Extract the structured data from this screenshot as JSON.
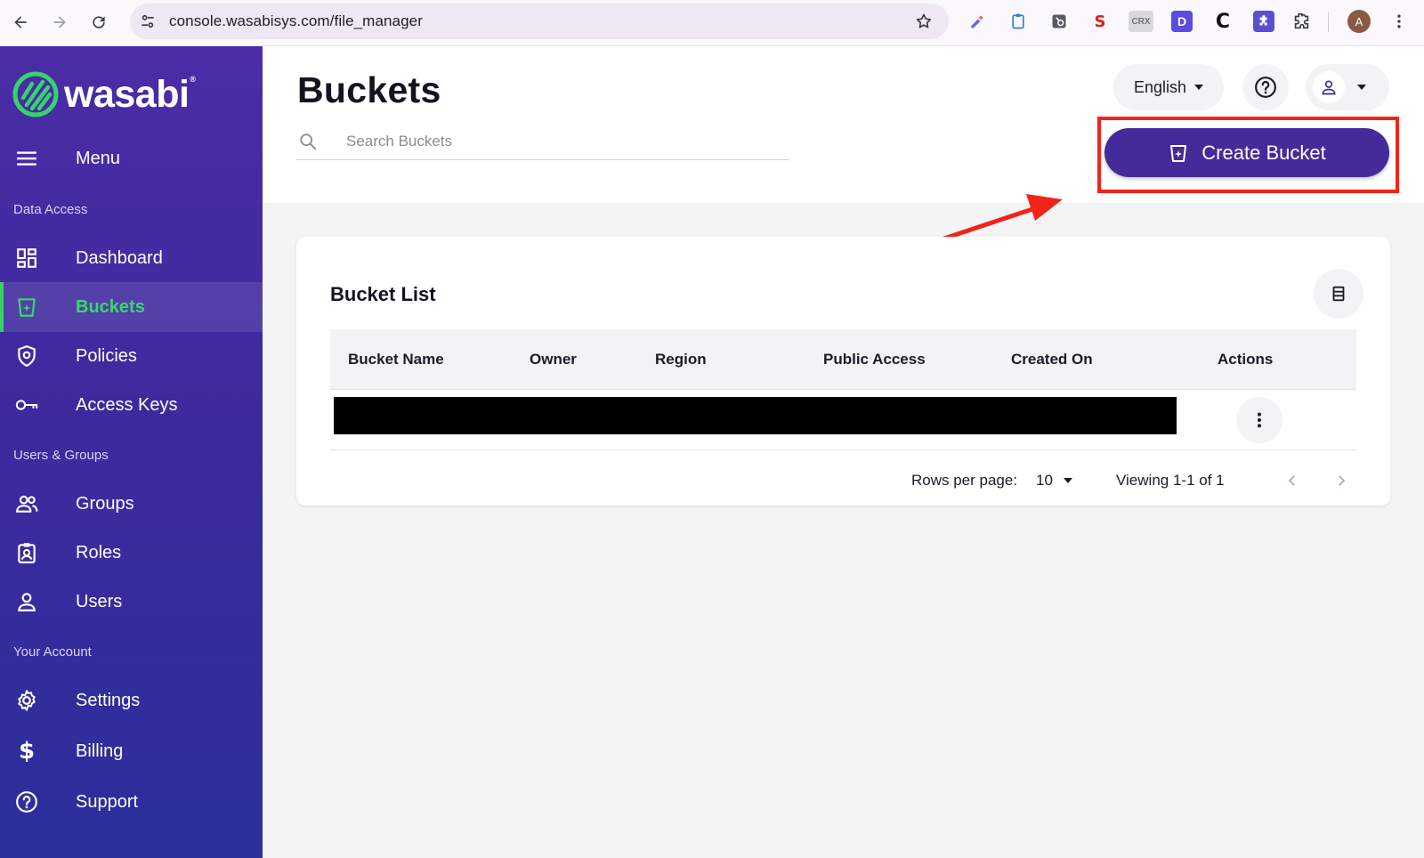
{
  "browser": {
    "url": "console.wasabisys.com/file_manager",
    "profile_initial": "A",
    "extensions": [
      {
        "name": "pen-extension-icon",
        "label": "",
        "color": "#6a6ad8"
      },
      {
        "name": "clipboard-extension-icon",
        "label": "",
        "color": "#3a7bd5"
      },
      {
        "name": "hubspot-extension-icon",
        "label": "",
        "color": "#5a5a66"
      },
      {
        "name": "seo-extension-icon",
        "label": "S",
        "color": "#d6231e"
      },
      {
        "name": "crx-extension-icon",
        "label": "CRX",
        "color": "#777777"
      },
      {
        "name": "d-extension-icon",
        "label": "D",
        "color": "#5b4bdf"
      },
      {
        "name": "c-extension-icon",
        "label": "C",
        "color": "#111111"
      },
      {
        "name": "puzzle-purple-extension-icon",
        "label": "",
        "color": "#5a4fcf"
      },
      {
        "name": "extensions-puzzle-icon",
        "label": "",
        "color": "#3a3a44"
      }
    ]
  },
  "brand": {
    "name": "wasabi",
    "trademark": "®",
    "logo_color": "#35d36c"
  },
  "sidebar": {
    "menu_label": "Menu",
    "sections": {
      "data_access": "Data Access",
      "users_groups": "Users & Groups",
      "your_account": "Your Account"
    },
    "items": [
      {
        "key": "dashboard",
        "label": "Dashboard",
        "icon": "dashboard-icon",
        "active": false
      },
      {
        "key": "buckets",
        "label": "Buckets",
        "icon": "bucket-icon",
        "active": true
      },
      {
        "key": "policies",
        "label": "Policies",
        "icon": "shield-icon",
        "active": false
      },
      {
        "key": "access_keys",
        "label": "Access Keys",
        "icon": "key-icon",
        "active": false
      },
      {
        "key": "groups",
        "label": "Groups",
        "icon": "group-icon",
        "active": false
      },
      {
        "key": "roles",
        "label": "Roles",
        "icon": "badge-icon",
        "active": false
      },
      {
        "key": "users",
        "label": "Users",
        "icon": "user-icon",
        "active": false
      },
      {
        "key": "settings",
        "label": "Settings",
        "icon": "gear-icon",
        "active": false
      },
      {
        "key": "billing",
        "label": "Billing",
        "icon": "dollar-icon",
        "active": false
      },
      {
        "key": "support",
        "label": "Support",
        "icon": "help-icon",
        "active": false
      }
    ]
  },
  "header": {
    "title": "Buckets",
    "search_placeholder": "Search Buckets",
    "language": "English",
    "create_button": "Create Bucket"
  },
  "bucket_list": {
    "title": "Bucket List",
    "columns": [
      "Bucket Name",
      "Owner",
      "Region",
      "Public Access",
      "Created On",
      "Actions"
    ],
    "rows_redacted": 1
  },
  "pagination": {
    "rows_per_page_label": "Rows per page:",
    "rows_per_page": "10",
    "viewing": "Viewing 1-1 of 1"
  },
  "colors": {
    "sidebar_top": "#4b2ca6",
    "sidebar_bottom": "#2a2f9c",
    "active_green": "#39d86b",
    "primary_button": "#452a99",
    "annotation_red": "#f2241a"
  }
}
